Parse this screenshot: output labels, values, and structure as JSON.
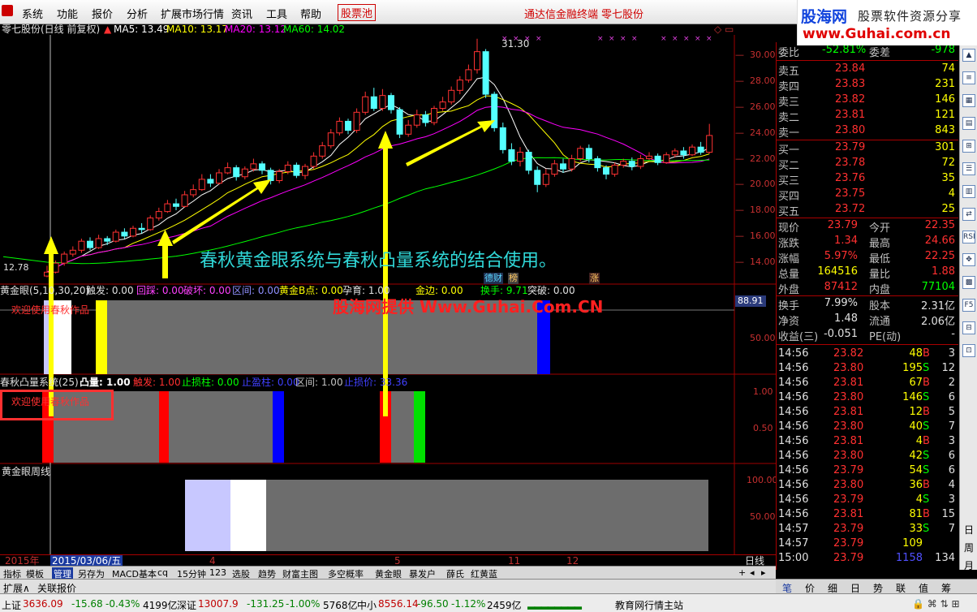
{
  "menu": {
    "items": [
      "系统",
      "功能",
      "报价",
      "分析",
      "扩展市场行情",
      "资讯",
      "工具",
      "帮助"
    ],
    "stock_pool": "股票池",
    "terminal": "通达信金融终端",
    "stock_name": "零七股份"
  },
  "brand": {
    "name": "股海网",
    "tagline": "股票软件资源分享",
    "url": "www.Guhai.com.cn"
  },
  "info": {
    "title": "零七股份(日线 前复权)",
    "ma5": "MA5: 13.49",
    "ma10": "MA10: 13.17",
    "ma20": "MA20: 13.12",
    "ma60": "MA60: 14.02"
  },
  "colors": {
    "up": "#ff3232",
    "down": "#54ffff",
    "ma5": "#ffffff",
    "ma10": "#ffff00",
    "ma20": "#ff00ff",
    "ma60": "#00ff00",
    "gray": "#6d6d6d",
    "red": "#ff0000",
    "blue": "#0000ff",
    "lightblue": "#c8c8ff"
  },
  "price_chart": {
    "y_ticks": [
      "30.00",
      "28.00",
      "26.00",
      "24.00",
      "22.00",
      "20.00",
      "18.00",
      "16.00",
      "14.00"
    ],
    "ymin": 12.4,
    "ymax": 31.6,
    "high_label": "31.30",
    "low_label": "12.78",
    "annotation": "春秋黄金眼系统与春秋凸量系统的结合使用。",
    "tags": [
      "德财",
      "榜",
      "涨"
    ],
    "candles": [
      [
        12.9,
        13.2,
        13.7,
        12.8
      ],
      [
        13.2,
        13.9,
        14.1,
        13.1
      ],
      [
        13.9,
        14.6,
        14.8,
        13.7
      ],
      [
        14.6,
        14.9,
        15.2,
        14.4
      ],
      [
        14.9,
        15.6,
        15.8,
        14.7
      ],
      [
        15.6,
        15.1,
        15.9,
        14.9
      ],
      [
        15.1,
        15.8,
        16.1,
        15.0
      ],
      [
        15.8,
        15.6,
        16.0,
        15.3
      ],
      [
        15.6,
        16.3,
        16.5,
        15.5
      ],
      [
        16.3,
        16.0,
        16.6,
        15.8
      ],
      [
        16.0,
        16.6,
        16.8,
        15.9
      ],
      [
        16.6,
        16.5,
        17.0,
        16.2
      ],
      [
        16.5,
        17.4,
        17.6,
        16.4
      ],
      [
        17.4,
        17.9,
        18.2,
        17.2
      ],
      [
        17.9,
        18.5,
        18.8,
        17.8
      ],
      [
        18.5,
        18.3,
        18.9,
        18.0
      ],
      [
        18.3,
        19.2,
        19.5,
        18.2
      ],
      [
        19.2,
        19.6,
        20.0,
        19.0
      ],
      [
        19.6,
        20.4,
        20.8,
        19.5
      ],
      [
        20.4,
        20.1,
        20.8,
        19.8
      ],
      [
        20.1,
        20.9,
        21.2,
        20.0
      ],
      [
        20.9,
        21.3,
        21.7,
        20.8
      ],
      [
        21.3,
        20.6,
        21.5,
        20.3
      ],
      [
        20.6,
        21.2,
        21.4,
        20.4
      ],
      [
        21.2,
        21.6,
        22.0,
        21.0
      ],
      [
        21.6,
        21.1,
        21.8,
        20.8
      ],
      [
        21.1,
        20.3,
        21.3,
        20.0
      ],
      [
        20.3,
        21.0,
        21.2,
        20.1
      ],
      [
        21.0,
        21.5,
        21.8,
        20.8
      ],
      [
        21.5,
        20.7,
        21.7,
        20.5
      ],
      [
        20.7,
        21.4,
        21.6,
        20.4
      ],
      [
        21.4,
        22.2,
        22.5,
        21.2
      ],
      [
        22.2,
        23.0,
        23.3,
        22.0
      ],
      [
        23.0,
        24.0,
        24.3,
        22.8
      ],
      [
        24.0,
        24.9,
        25.2,
        23.8
      ],
      [
        24.9,
        24.2,
        25.1,
        23.9
      ],
      [
        24.2,
        25.6,
        25.9,
        24.0
      ],
      [
        25.6,
        26.8,
        27.2,
        25.4
      ],
      [
        26.8,
        25.9,
        27.5,
        25.7
      ],
      [
        25.9,
        26.9,
        27.4,
        25.7
      ],
      [
        26.9,
        25.8,
        27.1,
        25.5
      ],
      [
        25.8,
        23.9,
        26.0,
        23.6
      ],
      [
        23.9,
        24.6,
        25.0,
        23.7
      ],
      [
        24.6,
        25.4,
        25.8,
        24.4
      ],
      [
        25.4,
        24.8,
        25.7,
        24.5
      ],
      [
        24.8,
        25.9,
        26.1,
        24.6
      ],
      [
        25.9,
        26.4,
        26.8,
        25.7
      ],
      [
        26.4,
        27.3,
        27.6,
        26.2
      ],
      [
        27.3,
        28.1,
        28.4,
        27.0
      ],
      [
        28.1,
        28.9,
        29.3,
        27.9
      ],
      [
        28.9,
        30.3,
        31.3,
        28.6
      ],
      [
        30.3,
        27.0,
        30.5,
        26.7
      ],
      [
        27.0,
        24.4,
        27.2,
        24.1
      ],
      [
        24.4,
        22.7,
        24.8,
        22.4
      ],
      [
        22.7,
        21.8,
        23.2,
        21.5
      ],
      [
        21.8,
        22.5,
        22.9,
        21.4
      ],
      [
        22.5,
        21.1,
        22.7,
        20.8
      ],
      [
        21.1,
        20.0,
        21.4,
        19.4
      ],
      [
        20.0,
        20.8,
        21.2,
        19.8
      ],
      [
        20.8,
        21.6,
        21.9,
        20.6
      ],
      [
        21.6,
        21.2,
        22.0,
        20.9
      ],
      [
        21.2,
        22.0,
        22.3,
        21.0
      ],
      [
        22.0,
        22.8,
        23.0,
        21.8
      ],
      [
        22.8,
        22.0,
        23.1,
        21.7
      ],
      [
        22.0,
        21.3,
        22.2,
        21.0
      ],
      [
        21.3,
        20.8,
        21.5,
        20.4
      ],
      [
        20.8,
        21.5,
        21.7,
        20.6
      ],
      [
        21.5,
        21.8,
        22.0,
        21.3
      ],
      [
        21.8,
        21.4,
        22.1,
        21.1
      ],
      [
        21.4,
        22.0,
        22.3,
        21.2
      ],
      [
        22.0,
        22.2,
        22.5,
        21.9
      ],
      [
        22.2,
        21.7,
        22.4,
        21.5
      ],
      [
        21.7,
        22.3,
        22.5,
        21.6
      ],
      [
        22.3,
        22.6,
        22.8,
        22.1
      ],
      [
        22.6,
        22.3,
        22.9,
        22.0
      ],
      [
        22.3,
        22.9,
        23.1,
        22.2
      ],
      [
        22.9,
        22.5,
        23.3,
        22.3
      ],
      [
        22.5,
        23.8,
        24.7,
        22.4
      ]
    ]
  },
  "panel1": {
    "header": [
      "黄金眼(5,10,30,20)",
      "触发: 0.00",
      "回踩: 0.00",
      "破坏: 0.00",
      "区间: 0.00",
      "黄金B点: 0.00",
      "孕育: 1.00",
      "金边: 0.00",
      "换手: 9.71",
      "突破: 0.00"
    ],
    "welcome": "欢迎使用春秋作品",
    "watermark": "股海网提供 Www.Guhai.Com.CN",
    "y_ticks": [
      "88.91",
      "50.00"
    ],
    "bands": [
      [
        54,
        64,
        "lightblue"
      ],
      [
        64,
        76,
        "white"
      ],
      [
        76,
        88,
        "white"
      ],
      [
        118,
        132,
        "yellow"
      ],
      [
        132,
        662,
        "gray"
      ],
      [
        662,
        678,
        "blue"
      ]
    ]
  },
  "panel2": {
    "header": [
      "春秋凸量系统(25)",
      "凸量: 1.00",
      "触发: 1.00",
      "止损柱: 0.00",
      "止盈柱: 0.00",
      "区间: 1.00",
      "止损价: 33.36"
    ],
    "welcome": "欢迎使用春秋作品",
    "y_ticks": [
      "1.00",
      "0.50"
    ],
    "bands": [
      [
        52,
        66,
        "red"
      ],
      [
        66,
        196,
        "gray"
      ],
      [
        196,
        208,
        "red"
      ],
      [
        208,
        336,
        "gray"
      ],
      [
        336,
        350,
        "blue"
      ],
      [
        468,
        482,
        "red"
      ],
      [
        482,
        510,
        "gray"
      ],
      [
        510,
        524,
        "green"
      ]
    ]
  },
  "panel3": {
    "header": "黄金眼周线",
    "y_ticks": [
      "100.00",
      "50.00"
    ],
    "bands": [
      [
        228,
        284,
        "lightblue"
      ],
      [
        284,
        328,
        "white"
      ],
      [
        328,
        873,
        "gray"
      ]
    ]
  },
  "quote": {
    "wei_bi_label": "委比",
    "wei_bi": "-52.81%",
    "wei_cha_label": "委差",
    "wei_cha": "-978",
    "sells": [
      [
        "卖五",
        "23.84",
        "74"
      ],
      [
        "卖四",
        "23.83",
        "231"
      ],
      [
        "卖三",
        "23.82",
        "146"
      ],
      [
        "卖二",
        "23.81",
        "121"
      ],
      [
        "卖一",
        "23.80",
        "843"
      ]
    ],
    "buys": [
      [
        "买一",
        "23.79",
        "301"
      ],
      [
        "买二",
        "23.78",
        "72"
      ],
      [
        "买三",
        "23.76",
        "35"
      ],
      [
        "买四",
        "23.75",
        "4"
      ],
      [
        "买五",
        "23.72",
        "25"
      ]
    ],
    "stats": [
      [
        "现价",
        "23.79",
        "今开",
        "22.35"
      ],
      [
        "涨跌",
        "1.34",
        "最高",
        "24.66"
      ],
      [
        "涨幅",
        "5.97%",
        "最低",
        "22.25"
      ],
      [
        "总量",
        "164516",
        "量比",
        "1.88"
      ],
      [
        "外盘",
        "87412",
        "内盘",
        "77104"
      ]
    ],
    "stats2": [
      [
        "换手",
        "7.99%",
        "股本",
        "2.31亿"
      ],
      [
        "净资",
        "1.48",
        "流通",
        "2.06亿"
      ],
      [
        "收益(三)",
        "-0.051",
        "PE(动)",
        "-"
      ]
    ],
    "ticks": [
      [
        "14:56",
        "23.82",
        "48",
        "B",
        "3"
      ],
      [
        "14:56",
        "23.80",
        "195",
        "S",
        "12"
      ],
      [
        "14:56",
        "23.81",
        "67",
        "B",
        "2"
      ],
      [
        "14:56",
        "23.80",
        "146",
        "S",
        "6"
      ],
      [
        "14:56",
        "23.81",
        "12",
        "B",
        "5"
      ],
      [
        "14:56",
        "23.80",
        "40",
        "S",
        "7"
      ],
      [
        "14:56",
        "23.81",
        "4",
        "B",
        "3"
      ],
      [
        "14:56",
        "23.80",
        "42",
        "S",
        "6"
      ],
      [
        "14:56",
        "23.79",
        "54",
        "S",
        "6"
      ],
      [
        "14:56",
        "23.80",
        "36",
        "B",
        "4"
      ],
      [
        "14:56",
        "23.79",
        "4",
        "S",
        "3"
      ],
      [
        "14:56",
        "23.81",
        "81",
        "B",
        "15"
      ],
      [
        "14:57",
        "23.79",
        "33",
        "S",
        "7"
      ],
      [
        "14:57",
        "23.79",
        "109",
        "",
        ""
      ],
      [
        "15:00",
        "23.79",
        "1158",
        "",
        "134"
      ]
    ]
  },
  "right_strip": {
    "chars": [
      "日",
      "周",
      "月"
    ]
  },
  "datebar": {
    "year": "2015年",
    "cursor_date": "2015/03/06/五",
    "months": [
      "4",
      "5",
      "11",
      "12"
    ],
    "period": "日线"
  },
  "tabbar": {
    "items": [
      "指标",
      "模板",
      "管理",
      "另存为",
      "MACD基本",
      "cq",
      "15分钟",
      "123",
      "选股",
      "趋势",
      "财富主图",
      "多空概率",
      "黄金眼",
      "暴发户",
      "薛氏",
      "红黄蓝"
    ]
  },
  "extbar": {
    "items": [
      "扩展∧",
      "关联报价"
    ]
  },
  "bottom_tabs": [
    "笔",
    "价",
    "细",
    "日",
    "势",
    "联",
    "值",
    "筹"
  ],
  "status": {
    "sh_label": "上证",
    "sh_val": "3636.09",
    "sh_chg": "-15.68",
    "sh_pct": "-0.43%",
    "sh_amt": "4199亿",
    "sz_label": "深证",
    "sz_val": "13007.9",
    "sz_chg": "-131.25",
    "sz_pct": "-1.00%",
    "sz_amt": "5768亿",
    "zx_label": "中小",
    "zx_val": "8556.14",
    "zx_chg": "-96.50",
    "zx_pct": "-1.12%",
    "zx_amt": "2459亿",
    "site": "教育网行情主站"
  }
}
